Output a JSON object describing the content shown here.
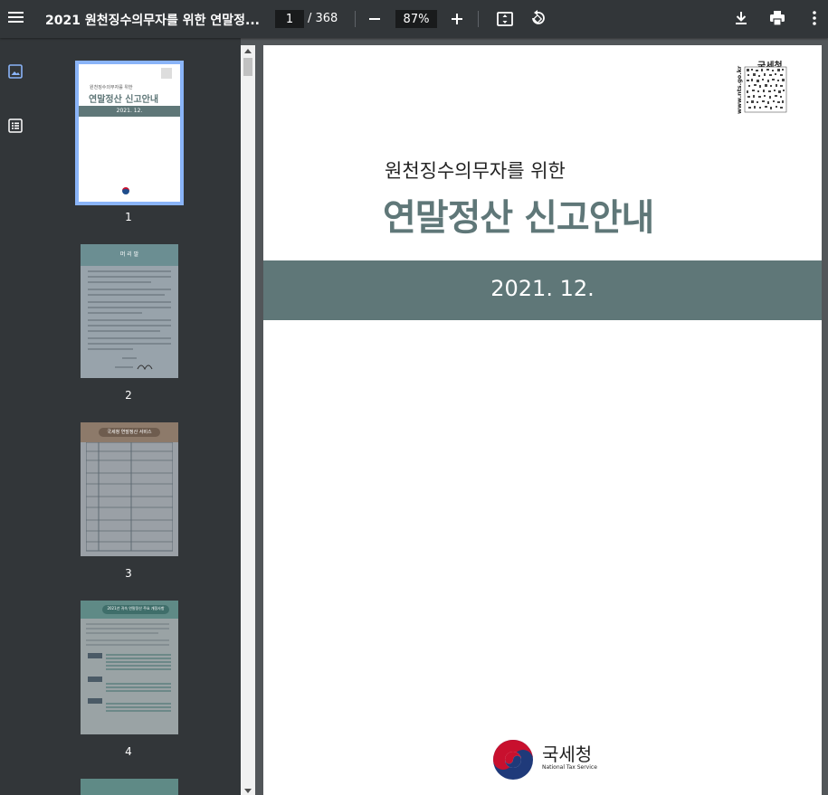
{
  "toolbar": {
    "title": "2021 원천징수의무자를 위한 연말정...",
    "current_page": "1",
    "total_pages": "/ 368",
    "zoom": "87%"
  },
  "sidebar": {
    "thumbnails": [
      {
        "label": "1",
        "title_small": "원천징수의무자를 위한",
        "title_large": "연말정산 신고안내",
        "date": "2021. 12."
      },
      {
        "label": "2",
        "header": "머 리 말"
      },
      {
        "label": "3",
        "header": "국세청 연말정산 서비스"
      },
      {
        "label": "4",
        "header": "2021년 귀속 연말정산 주요 개정사항"
      }
    ]
  },
  "page": {
    "subtitle": "원천징수의무자를 위한",
    "title": "연말정산 신고안내",
    "date": "2021. 12.",
    "qr_label": "국세청",
    "qr_url": "www.nts.go.kr",
    "logo_text": "국세청",
    "logo_sub": "National Tax Service"
  },
  "colors": {
    "toolbar_bg": "#323639",
    "viewer_bg": "#525659",
    "accent_band": "#5f7778",
    "thumb_selected_border": "#8ab4f8"
  }
}
